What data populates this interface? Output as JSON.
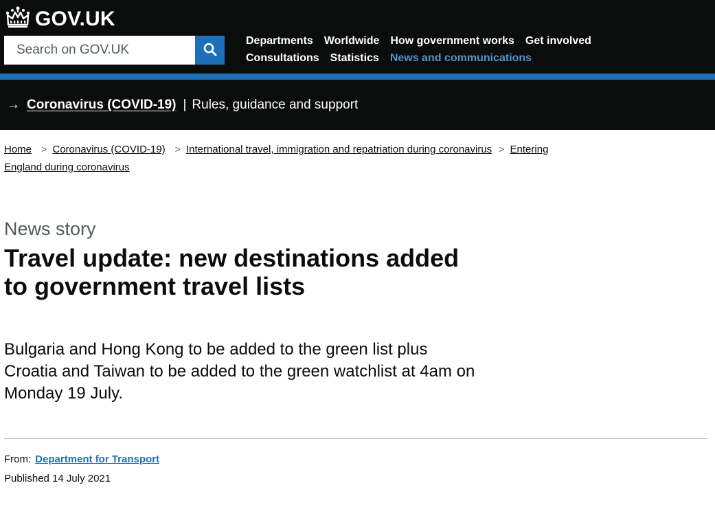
{
  "header": {
    "logo_text": "GOV.UK",
    "search": {
      "placeholder": "Search on GOV.UK",
      "button_icon": "search-icon"
    },
    "nav": [
      {
        "label": "Departments",
        "active": false
      },
      {
        "label": "Worldwide",
        "active": false
      },
      {
        "label": "How government works",
        "active": false
      },
      {
        "label": "Get involved",
        "active": false
      },
      {
        "label": "Consultations",
        "active": false
      },
      {
        "label": "Statistics",
        "active": false
      },
      {
        "label": "News and communications",
        "active": true
      }
    ]
  },
  "covid_banner": {
    "arrow": "→",
    "link": "Coronavirus (COVID-19)",
    "separator": "|",
    "subtitle": "Rules, guidance and support"
  },
  "breadcrumbs": [
    "Home",
    "Coronavirus (COVID-19)",
    "International travel, immigration and repatriation during coronavirus",
    "Entering England during coronavirus"
  ],
  "article": {
    "caption": "News story",
    "title": "Travel update: new destinations added to government travel lists",
    "lead": "Bulgaria and Hong Kong to be added to the green list plus Croatia and Taiwan to be added to the green watchlist at 4am on Monday 19 July.",
    "from_label": "From:",
    "from_org": "Department for Transport",
    "published": "Published 14 July 2021"
  },
  "colors": {
    "header_bg": "#0b0c0c",
    "brand_blue": "#1d70b8",
    "active_link": "#5694ca",
    "secondary_text": "#505a5f"
  }
}
